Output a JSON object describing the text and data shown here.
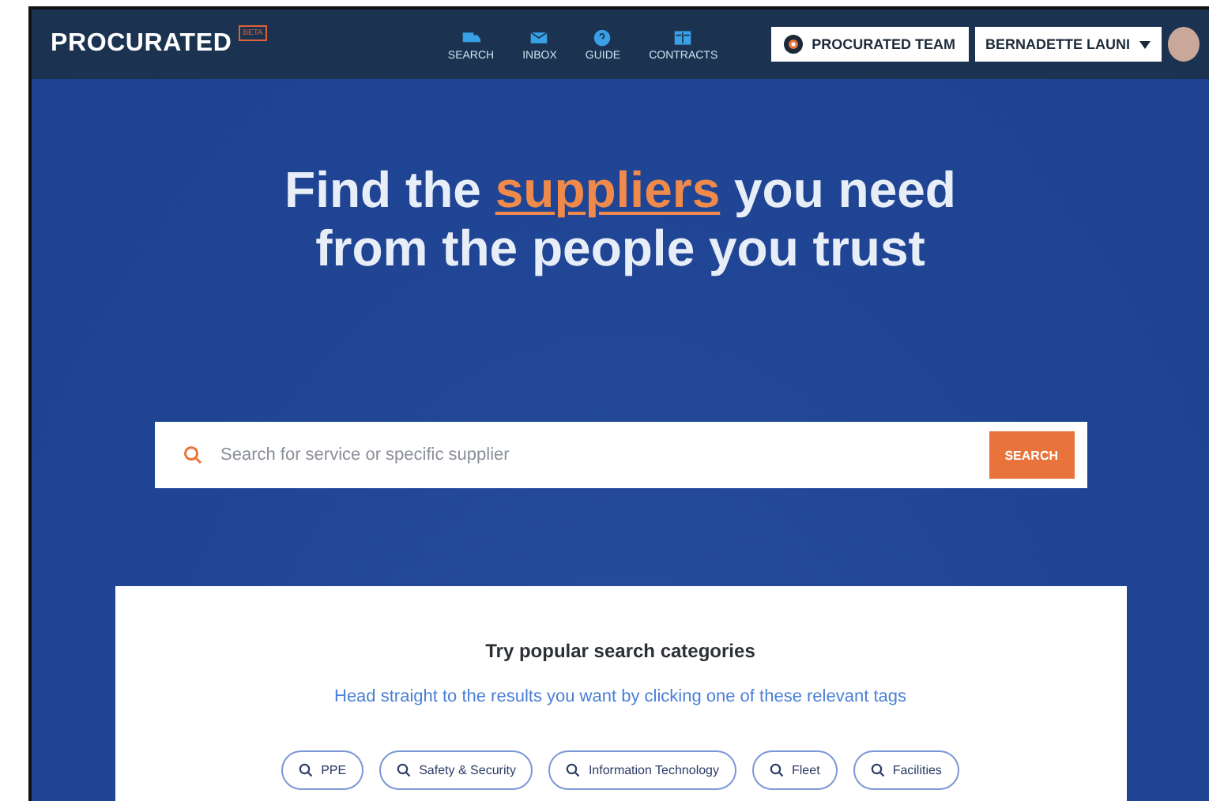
{
  "header": {
    "logo": "PROCURATED",
    "badge": "BETA",
    "nav": [
      {
        "label": "SEARCH",
        "kind": "search"
      },
      {
        "label": "INBOX",
        "kind": "inbox"
      },
      {
        "label": "GUIDE",
        "kind": "guide"
      },
      {
        "label": "CONTRACTS",
        "kind": "contracts"
      }
    ],
    "team_button": "PROCURATED TEAM",
    "user_menu": "BERNADETTE LAUNI"
  },
  "hero": {
    "headline_before": "Find the ",
    "headline_highlight": "suppliers",
    "headline_after": " you need",
    "headline_line2": "from the people you trust"
  },
  "search": {
    "placeholder": "Search for service or specific supplier",
    "button": "SEARCH"
  },
  "categories": {
    "title": "Try popular search categories",
    "subtitle": "Head straight to the results you want by clicking one of these relevant tags",
    "tags": [
      "PPE",
      "Safety & Security",
      "Information Technology",
      "Fleet",
      "Facilities"
    ]
  }
}
